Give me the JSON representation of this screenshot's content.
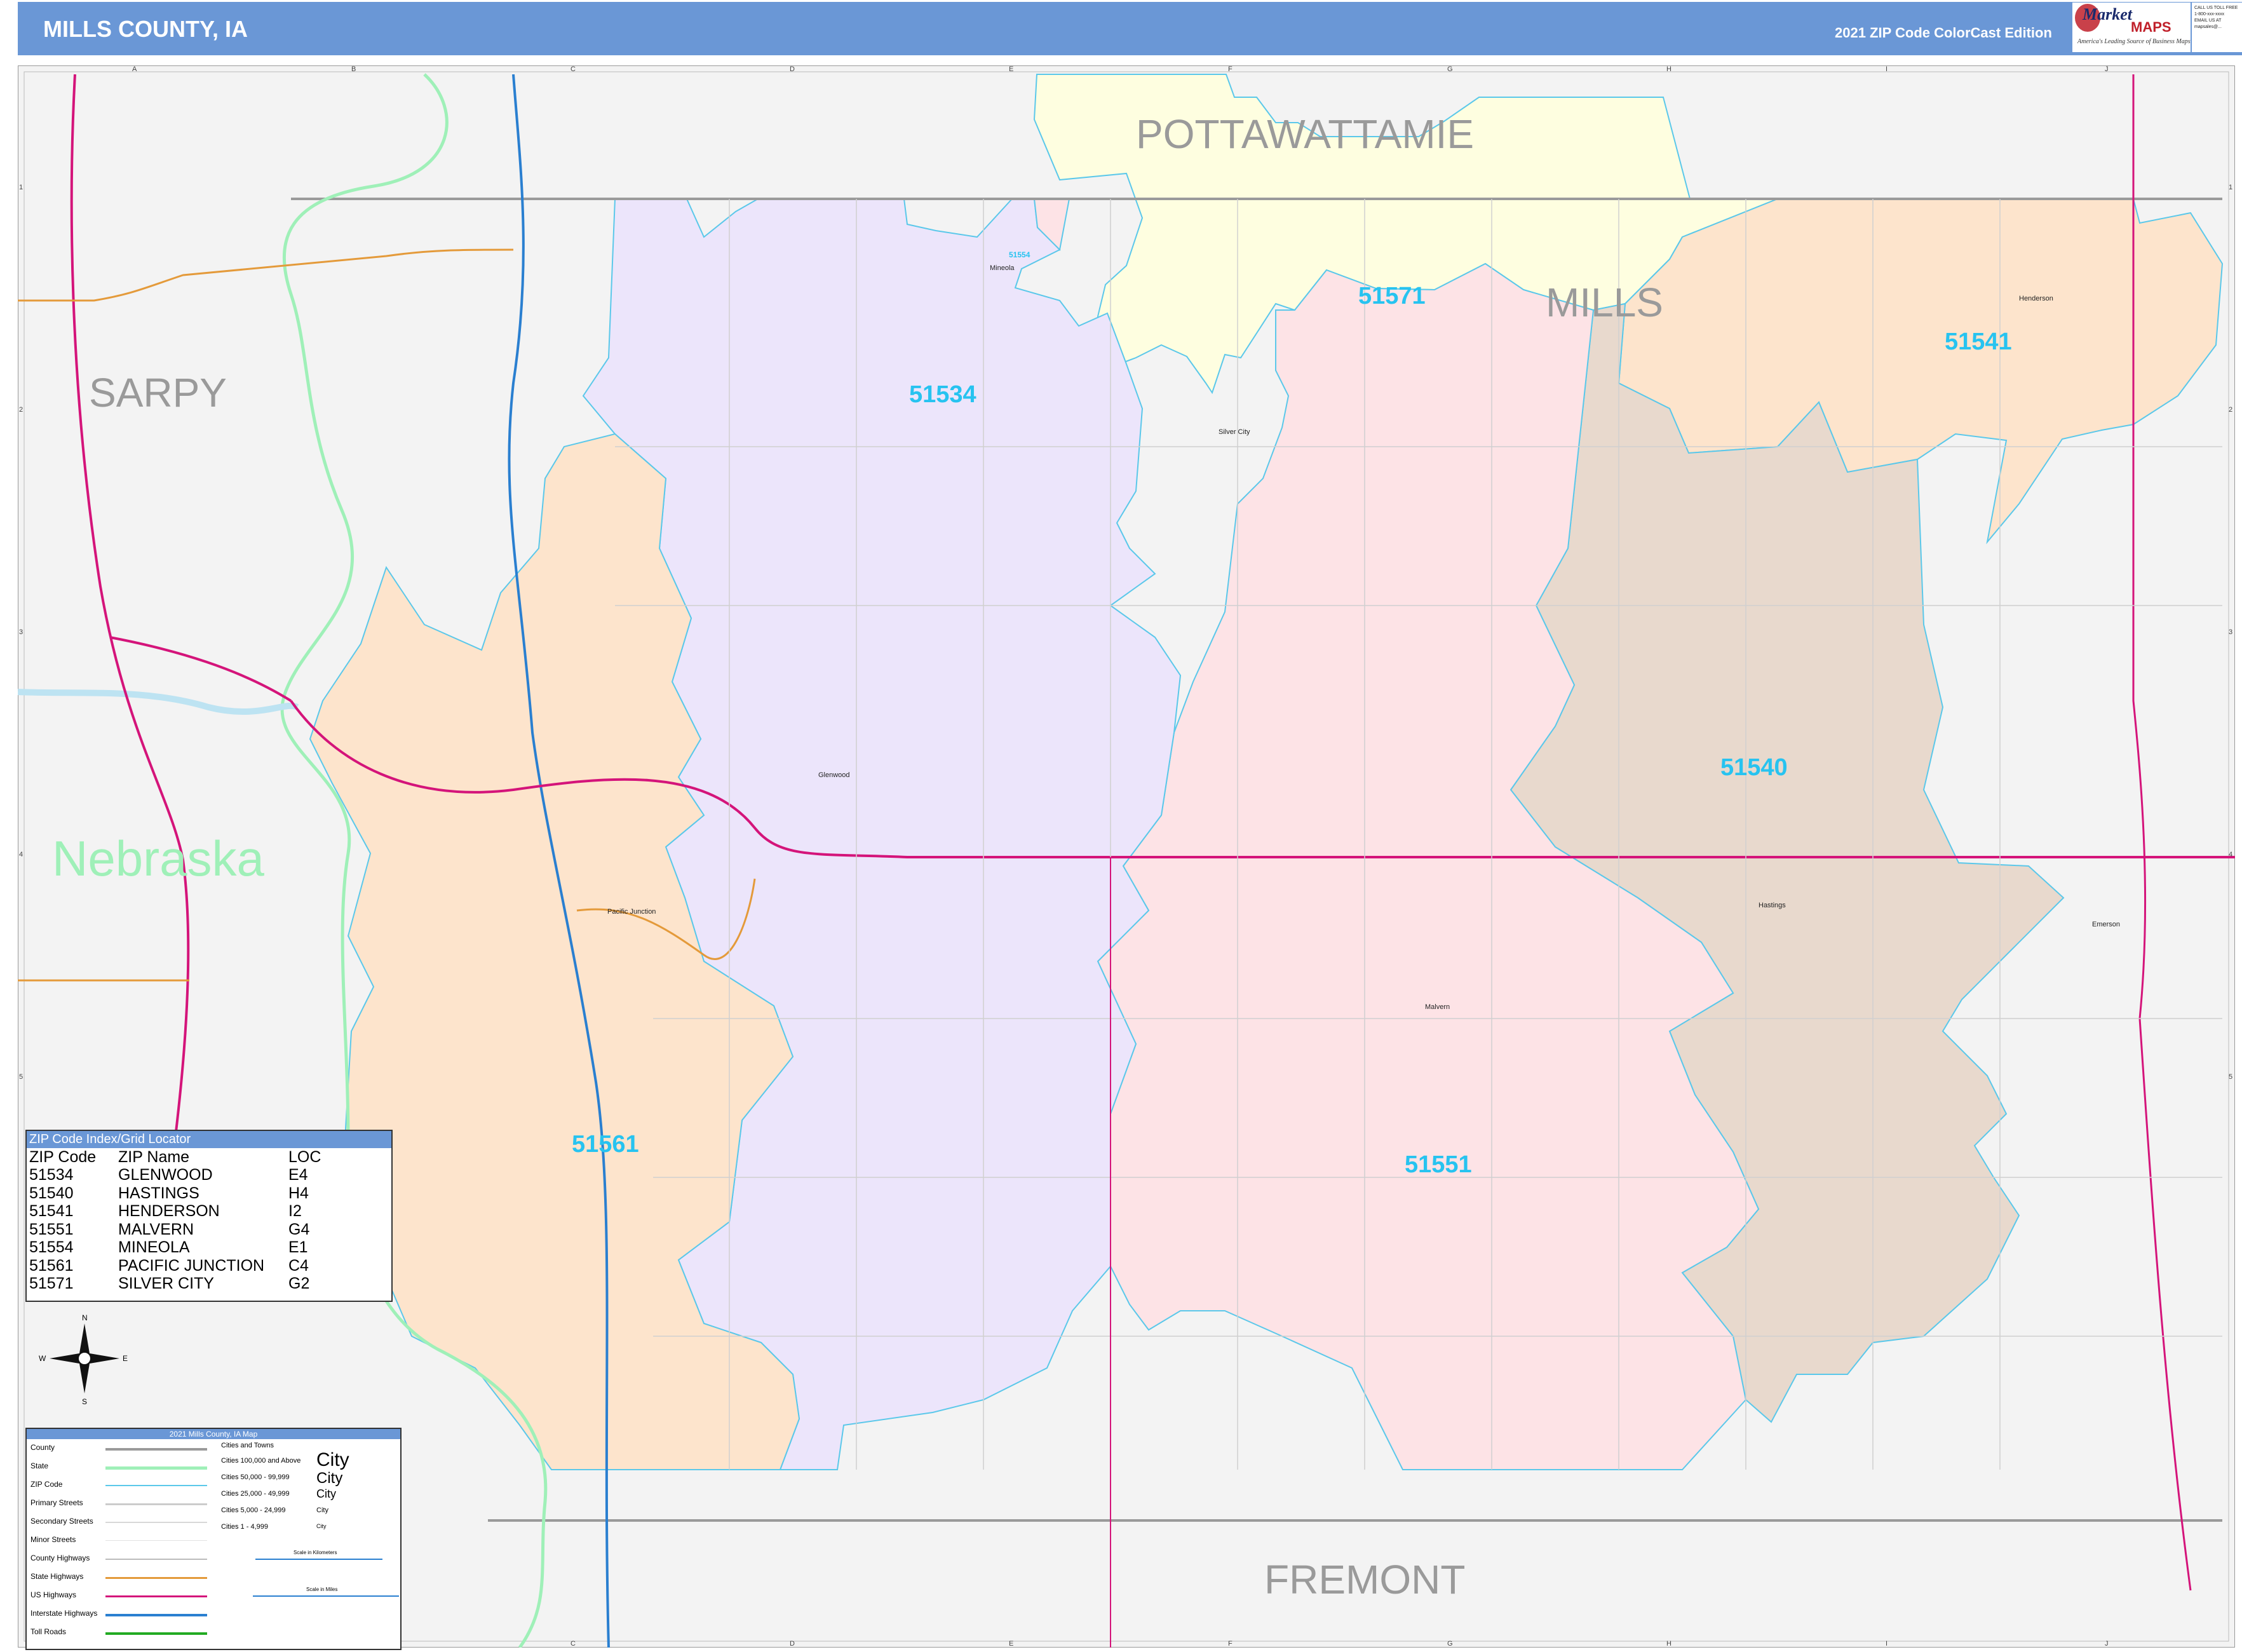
{
  "header": {
    "title": "MILLS COUNTY, IA",
    "edition": "2021 ZIP Code ColorCast Edition",
    "logo_brand_top": "Market",
    "logo_brand_bottom": "MAPS",
    "logo_tagline": "America's Leading Source of Business Maps",
    "contact_lines": [
      "CALL US TOLL FREE",
      "1-800-xxx-xxxx",
      "EMAIL US AT",
      "mapsales@..."
    ]
  },
  "map": {
    "grid_columns": [
      "A",
      "B",
      "C",
      "D",
      "E",
      "F",
      "G",
      "H",
      "I",
      "J"
    ],
    "grid_rows": [
      "1",
      "2",
      "3",
      "4",
      "5"
    ],
    "regions": {
      "pottawattamie": "POTTAWATTAMIE",
      "mills": "MILLS",
      "sarpy": "SARPY",
      "nebraska": "Nebraska",
      "fremont": "FREMONT"
    },
    "zip_labels": {
      "z51534": "51534",
      "z51571": "51571",
      "z51541": "51541",
      "z51540": "51540",
      "z51561": "51561",
      "z51551": "51551",
      "z51554": "51554"
    },
    "towns": {
      "glenwood": "Glenwood",
      "malvern": "Malvern",
      "hastings": "Hastings",
      "henderson": "Henderson",
      "mineola": "Mineola",
      "silver_city": "Silver City",
      "pacific_junction": "Pacific Junction",
      "emerson": "Emerson"
    },
    "zip_colors": {
      "51534": "#ece5fb",
      "51571": "#fefee0",
      "51541": "#fde4cc",
      "51540": "#e8d9cd",
      "51561": "#fde4cc",
      "51551": "#fde3e6",
      "51554": "#fde3e6"
    },
    "zip_boundary_color": "#5bc8ea",
    "us_highway_color": "#d4147a",
    "interstate_color": "#2a7fd0",
    "state_highway_color": "#e49a3a",
    "state_line_color": "#9ff0b8"
  },
  "compass": {
    "n": "N",
    "s": "S",
    "e": "E",
    "w": "W"
  },
  "zip_index": {
    "title": "ZIP Code Index/Grid Locator",
    "columns": [
      "ZIP Code",
      "ZIP Name",
      "LOC"
    ],
    "rows": [
      [
        "51534",
        "GLENWOOD",
        "E4"
      ],
      [
        "51540",
        "HASTINGS",
        "H4"
      ],
      [
        "51541",
        "HENDERSON",
        "I2"
      ],
      [
        "51551",
        "MALVERN",
        "G4"
      ],
      [
        "51554",
        "MINEOLA",
        "E1"
      ],
      [
        "51561",
        "PACIFIC JUNCTION",
        "C4"
      ],
      [
        "51571",
        "SILVER CITY",
        "G2"
      ]
    ]
  },
  "legend": {
    "title": "2021 Mills County, IA Map",
    "items": [
      "County",
      "State",
      "ZIP Code",
      "Primary Streets",
      "Secondary Streets",
      "Minor Streets",
      "County Highways",
      "State Highways",
      "US Highways",
      "Interstate Highways",
      "Toll Roads"
    ],
    "cities_title": "Cities and Towns",
    "city_tiers": [
      "Cities 100,000 and Above",
      "Cities 50,000 - 99,999",
      "Cities 25,000 - 49,999",
      "Cities 5,000 - 24,999",
      "Cities 1 - 4,999"
    ],
    "city_word": "City",
    "scale_km": "Scale in Kilometers",
    "scale_mi": "Scale in Miles"
  }
}
